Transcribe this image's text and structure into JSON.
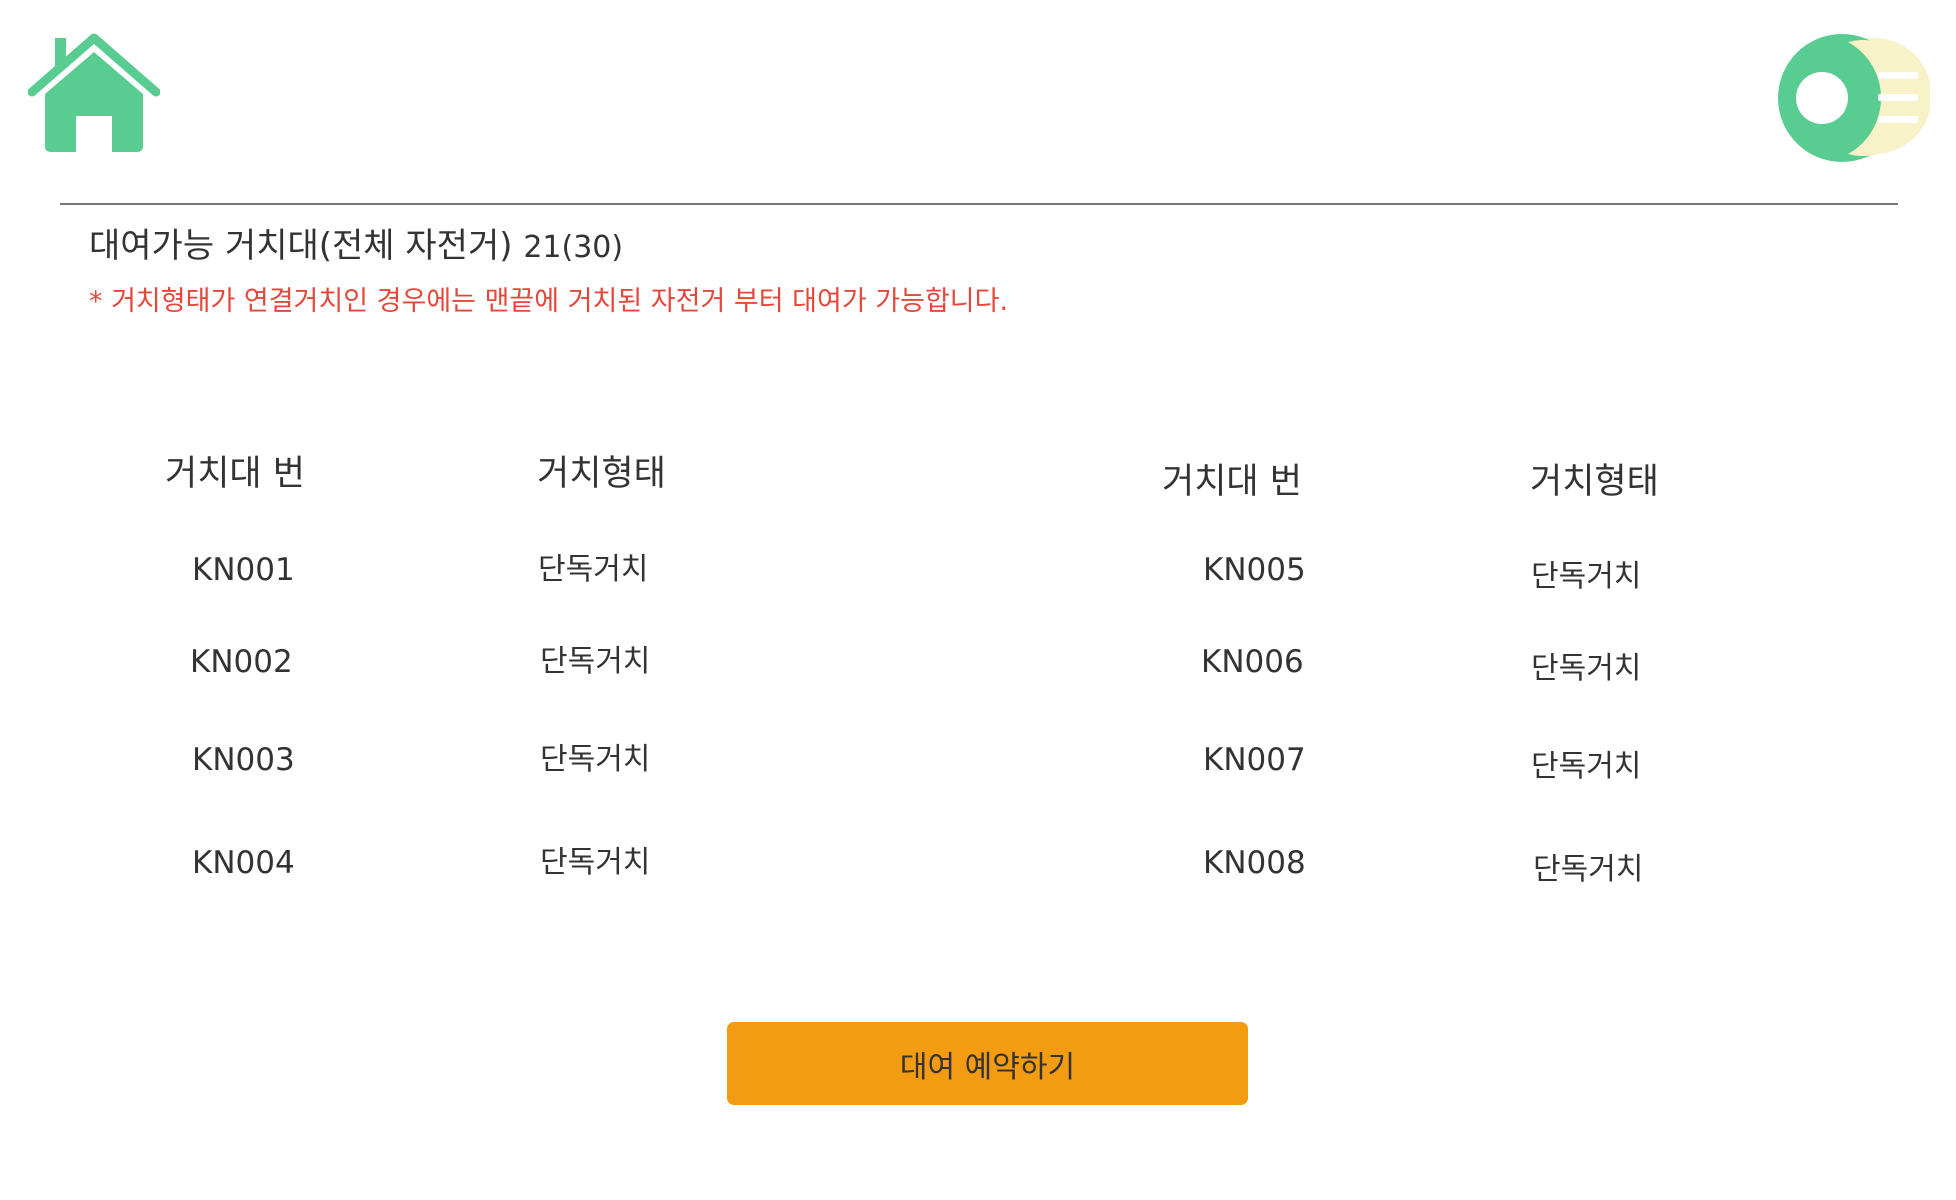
{
  "header": {
    "home_icon": "home-icon",
    "menu_icon": "menu-icon",
    "accent_color": "#59cc92",
    "menu_back_color": "#f8f2c8"
  },
  "info": {
    "title": "대여가능 거치대(전체 자전거)",
    "count": "21(30)",
    "notice": "* 거치형태가 연결거치인 경우에는 맨끝에 거치된 자전거 부터 대여가 가능합니다.",
    "notice_color": "#e5473b"
  },
  "table": {
    "headers": [
      "거치대 번",
      "거치형태",
      "거치대 번",
      "거치형태"
    ],
    "left_rows": [
      {
        "id": "KN001",
        "type": "단독거치"
      },
      {
        "id": "KN002",
        "type": "단독거치"
      },
      {
        "id": "KN003",
        "type": "단독거치"
      },
      {
        "id": "KN004",
        "type": "단독거치"
      }
    ],
    "right_rows": [
      {
        "id": "KN005",
        "type": "단독거치"
      },
      {
        "id": "KN006",
        "type": "단독거치"
      },
      {
        "id": "KN007",
        "type": "단독거치"
      },
      {
        "id": "KN008",
        "type": "단독거치"
      }
    ]
  },
  "actions": {
    "reserve_label": "대여 예약하기",
    "button_color": "#f39c12"
  }
}
